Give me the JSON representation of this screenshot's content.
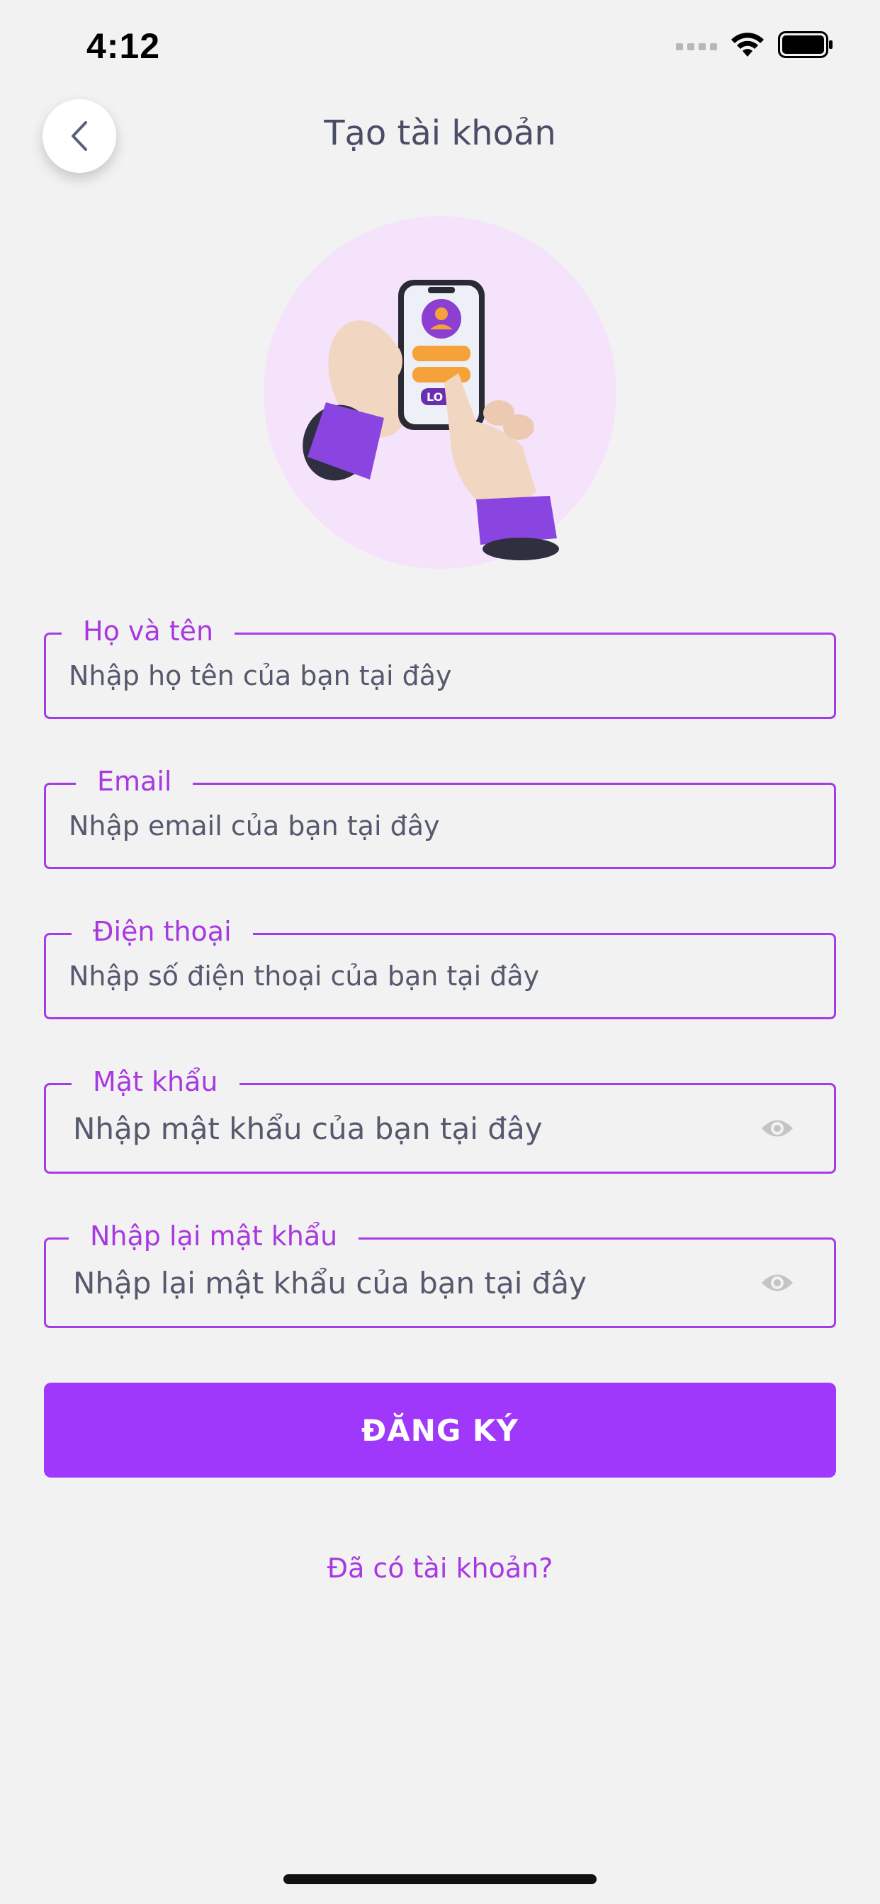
{
  "status_bar": {
    "time": "4:12"
  },
  "header": {
    "title": "Tạo tài khoản"
  },
  "form": {
    "fields": [
      {
        "label": "Họ và tên",
        "placeholder": "Nhập họ tên của bạn tại đây"
      },
      {
        "label": "Email",
        "placeholder": "Nhập email của bạn tại đây"
      },
      {
        "label": "Điện thoại",
        "placeholder": "Nhập số điện thoại của bạn tại đây"
      },
      {
        "label": "Mật khẩu",
        "placeholder": "Nhập mật khẩu của bạn tại đây"
      },
      {
        "label": "Nhập lại mật khẩu",
        "placeholder": "Nhập lại mật khẩu của bạn tại đây"
      }
    ],
    "submit_label": "ĐĂNG KÝ",
    "login_link": "Đã có tài khoản?"
  },
  "hero": {
    "badge_text": "LO"
  },
  "colors": {
    "accent": "#9f38fb",
    "label": "#a838e0",
    "background": "#f2f2f2"
  }
}
